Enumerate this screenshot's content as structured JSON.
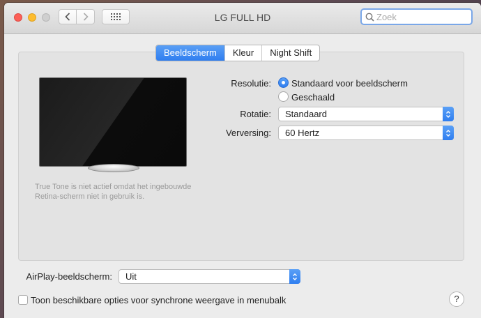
{
  "window": {
    "title": "LG FULL HD"
  },
  "search": {
    "placeholder": "Zoek"
  },
  "tabs": [
    {
      "label": "Beeldscherm",
      "active": true
    },
    {
      "label": "Kleur",
      "active": false
    },
    {
      "label": "Night Shift",
      "active": false
    }
  ],
  "display": {
    "true_tone_note": "True Tone is niet actief omdat het ingebouwde Retina-scherm niet in gebruik is."
  },
  "settings": {
    "resolution_label": "Resolutie:",
    "resolution_options": [
      {
        "label": "Standaard voor beeldscherm",
        "selected": true
      },
      {
        "label": "Geschaald",
        "selected": false
      }
    ],
    "rotation_label": "Rotatie:",
    "rotation_value": "Standaard",
    "refresh_label": "Verversing:",
    "refresh_value": "60 Hertz"
  },
  "airplay": {
    "label": "AirPlay-beeldscherm:",
    "value": "Uit"
  },
  "menubar_option": {
    "label": "Toon beschikbare opties voor synchrone weergave in menubalk",
    "checked": false
  },
  "help": {
    "label": "?"
  },
  "colors": {
    "accent": "#2f7ef0",
    "window_bg": "#ececec"
  }
}
